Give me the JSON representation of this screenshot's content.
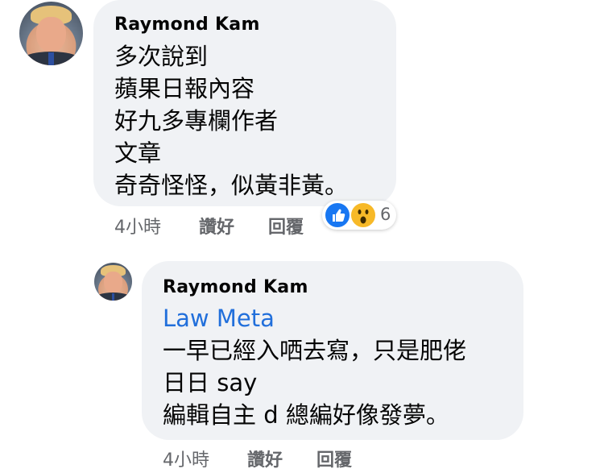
{
  "comments": [
    {
      "author": "Raymond  Kam",
      "lines": [
        "多次說到",
        "蘋果日報內容",
        "好九多專欄作者",
        "文章",
        "奇奇怪怪，似黃非黃。"
      ],
      "time": "4小時",
      "like_label": "讚好",
      "reply_label": "回覆",
      "reactions": {
        "icons": [
          "like-icon",
          "wow-icon"
        ],
        "count": "6"
      }
    },
    {
      "author": "Raymond  Kam",
      "mention": "Law Meta",
      "lines": [
        "一早已經入哂去寫，只是肥佬",
        "日日 say",
        "編輯自主 d 總編好像發夢。"
      ],
      "time": "4小時",
      "like_label": "讚好",
      "reply_label": "回覆"
    }
  ],
  "colors": {
    "bubble": "#f0f2f5",
    "mention": "#216fdb",
    "meta": "#65676b",
    "like": "#1877f2",
    "wow": "#f7b928"
  }
}
